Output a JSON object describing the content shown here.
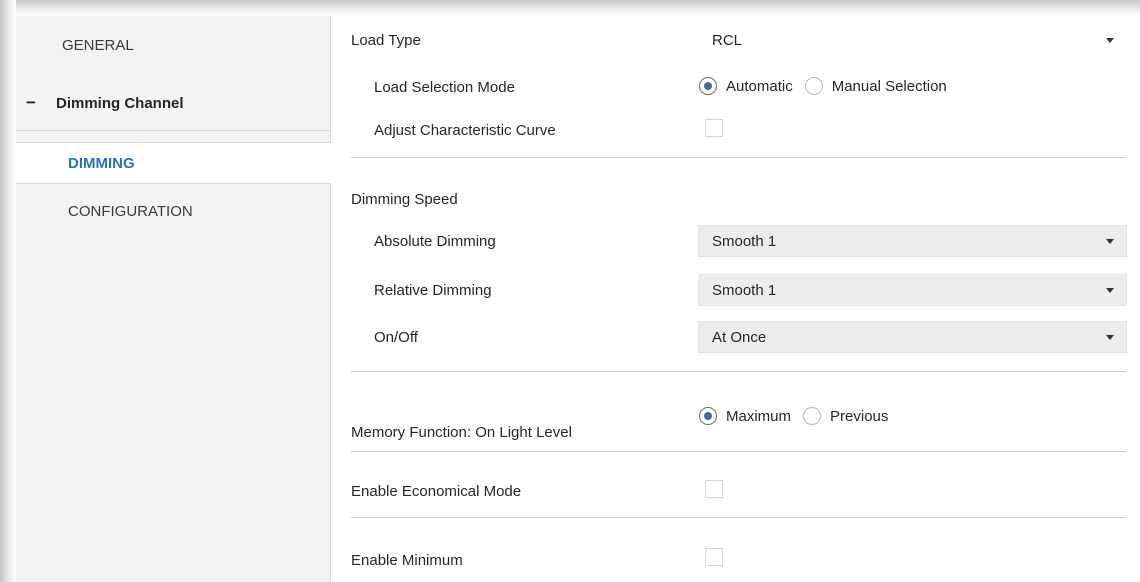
{
  "sidebar": {
    "general": "GENERAL",
    "group": {
      "toggle": "−",
      "label": "Dimming Channel"
    },
    "dimming": "DIMMING",
    "configuration": "CONFIGURATION"
  },
  "params": {
    "load_type": {
      "label": "Load Type",
      "value": "RCL"
    },
    "load_selection_mode": {
      "label": "Load Selection Mode",
      "options": [
        "Automatic",
        "Manual Selection"
      ],
      "selected": "Automatic"
    },
    "adjust_curve": {
      "label": "Adjust Characteristic Curve",
      "checked": false
    },
    "dimming_speed": {
      "label": "Dimming Speed"
    },
    "absolute_dimming": {
      "label": "Absolute Dimming",
      "value": "Smooth 1"
    },
    "relative_dimming": {
      "label": "Relative Dimming",
      "value": "Smooth 1"
    },
    "on_off": {
      "label": "On/Off",
      "value": "At Once"
    },
    "memory_function": {
      "label": "Memory Function: On Light Level",
      "options": [
        "Maximum",
        "Previous"
      ],
      "selected": "Maximum"
    },
    "economical_mode": {
      "label": "Enable Economical Mode",
      "checked": false
    },
    "enable_minimum": {
      "label": "Enable Minimum",
      "checked": false
    }
  },
  "colors": {
    "accent": "#2b73b5",
    "radio_dot": "#4a6a8c",
    "sidebar_bg": "#f3f3f3",
    "field_bg": "#ededed"
  }
}
